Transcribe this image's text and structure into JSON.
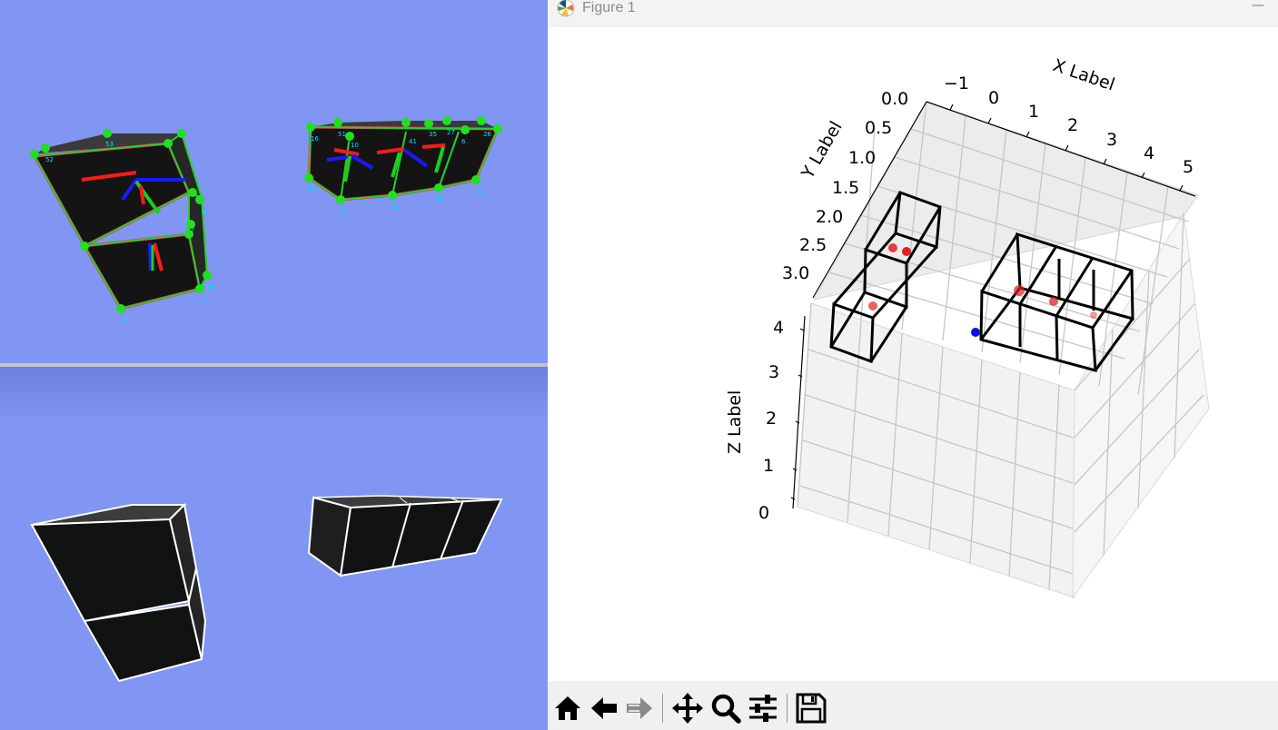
{
  "window": {
    "title": "Figure 1",
    "minimize_glyph": "—"
  },
  "viewport_top": {
    "background": "#8096f2",
    "point_labels": [
      "53",
      "52",
      "9",
      "7",
      "21",
      "14",
      "48",
      "16",
      "51",
      "10",
      "41",
      "35",
      "27",
      "6",
      "26",
      "29",
      "28",
      "31",
      "32",
      "30"
    ]
  },
  "viewport_bottom": {
    "background": "#8096f2"
  },
  "toolbar": {
    "tools": [
      {
        "name": "home",
        "icon": "home-icon"
      },
      {
        "name": "back",
        "icon": "left-arrow-icon"
      },
      {
        "name": "forward",
        "icon": "right-arrow-icon"
      },
      {
        "name": "pan",
        "icon": "move-icon"
      },
      {
        "name": "zoom",
        "icon": "zoom-icon"
      },
      {
        "name": "configure",
        "icon": "sliders-icon"
      },
      {
        "name": "save",
        "icon": "floppy-icon"
      }
    ]
  },
  "chart_data": {
    "type": "scatter",
    "projection": "3d",
    "xlabel": "X Label",
    "ylabel": "Y Label",
    "zlabel": "Z Label",
    "x_ticks": [
      "−1",
      "0",
      "1",
      "2",
      "3",
      "4",
      "5"
    ],
    "y_ticks": [
      "0.0",
      "0.5",
      "1.0",
      "1.5",
      "2.0",
      "2.5",
      "3.0"
    ],
    "z_ticks": [
      "0",
      "1",
      "2",
      "3",
      "4"
    ],
    "grid": true,
    "colors": {
      "points_red": "#e02020",
      "point_blue": "#1010e0",
      "boxes": "#000000"
    }
  }
}
